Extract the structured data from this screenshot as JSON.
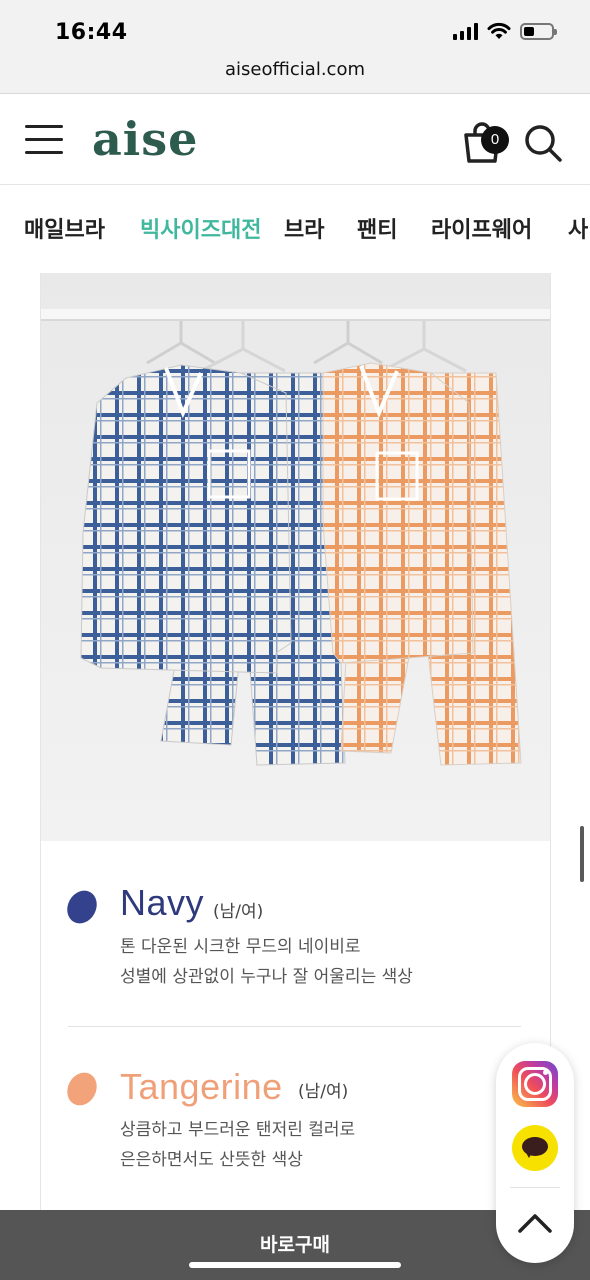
{
  "status_bar": {
    "time": "16:44"
  },
  "browser": {
    "url": "aiseofficial.com"
  },
  "header": {
    "logo": "aise",
    "cart_count": "0"
  },
  "category_nav": {
    "items": [
      {
        "label": "매일브라",
        "active": false
      },
      {
        "label": "빅사이즈대전",
        "active": true
      },
      {
        "label": "브라",
        "active": false
      },
      {
        "label": "팬티",
        "active": false
      },
      {
        "label": "라이프웨어",
        "active": false
      },
      {
        "label": "사",
        "active": false
      }
    ],
    "active_color": "#3fb89d"
  },
  "colors": [
    {
      "name": "Navy",
      "gender": "(남/여)",
      "swatch": "#34418c",
      "name_color": "#2f3a7d",
      "desc_lines": [
        "톤 다운된 시크한 무드의 네이비로",
        "성별에 상관없이 누구나 잘 어울리는 색상"
      ]
    },
    {
      "name": "Tangerine",
      "gender": "(남/여)",
      "swatch": "#f3a37a",
      "name_color": "#f0a079",
      "desc_lines": [
        "상큼하고 부드러운 탠저린 컬러로",
        "은은하면서도 산뜻한 색상"
      ]
    }
  ],
  "floating_buttons": {
    "instagram_icon": "instagram-icon",
    "kakao_icon": "kakaotalk-icon",
    "top_icon": "chevron-up-icon"
  },
  "bottom_bar": {
    "buy_label": "바로구매"
  }
}
